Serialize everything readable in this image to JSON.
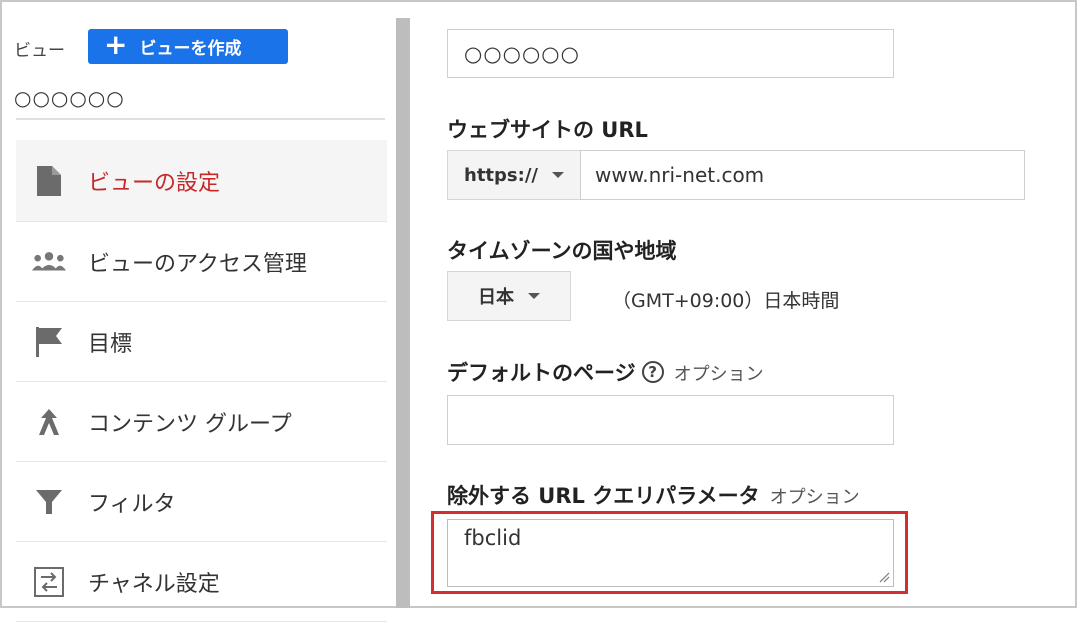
{
  "sidebar": {
    "view_label": "ビュー",
    "create_button": "ビューを作成",
    "view_name": "○○○○○○",
    "items": [
      {
        "label": "ビューの設定",
        "icon": "document-icon",
        "active": true
      },
      {
        "label": "ビューのアクセス管理",
        "icon": "people-icon",
        "active": false
      },
      {
        "label": "目標",
        "icon": "flag-icon",
        "active": false
      },
      {
        "label": "コンテンツ グループ",
        "icon": "content-grouping-icon",
        "active": false
      },
      {
        "label": "フィルタ",
        "icon": "filter-icon",
        "active": false
      },
      {
        "label": "チャネル設定",
        "icon": "channel-settings-icon",
        "active": false
      }
    ]
  },
  "form": {
    "view_name_value": "○○○○○○",
    "website_url": {
      "heading": "ウェブサイトの URL",
      "protocol": "https://",
      "value": "www.nri-net.com"
    },
    "timezone": {
      "heading": "タイムゾーンの国や地域",
      "country": "日本",
      "zone": "（GMT+09:00）日本時間"
    },
    "default_page": {
      "heading": "デフォルトのページ",
      "optional": "オプション",
      "value": ""
    },
    "exclude_params": {
      "heading": "除外する URL クエリパラメータ",
      "optional": "オプション",
      "value": "fbclid"
    }
  },
  "colors": {
    "accent_blue": "#1a73e8",
    "active_red": "#c62828",
    "highlight_border": "#d32f2f"
  }
}
